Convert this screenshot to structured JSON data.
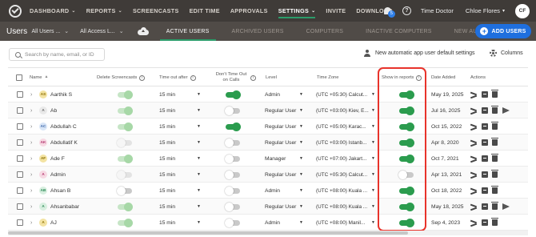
{
  "nav": {
    "items": [
      {
        "label": "DASHBOARD",
        "has_caret": true,
        "active": false
      },
      {
        "label": "REPORTS",
        "has_caret": true,
        "active": false
      },
      {
        "label": "SCREENCASTS",
        "has_caret": false,
        "active": false
      },
      {
        "label": "EDIT TIME",
        "has_caret": false,
        "active": false
      },
      {
        "label": "APPROVALS",
        "has_caret": false,
        "active": false
      },
      {
        "label": "SETTINGS",
        "has_caret": true,
        "active": true
      },
      {
        "label": "INVITE",
        "has_caret": false,
        "active": false
      },
      {
        "label": "DOWNLOAD",
        "has_caret": false,
        "active": false
      }
    ],
    "notification_count": "5",
    "help": "?",
    "company": "Time Doctor",
    "user": "Chloe Flores",
    "user_initials": "CF"
  },
  "subheader": {
    "title": "Users",
    "filter_users": "All Users ...",
    "filter_access": "All Access L...",
    "tabs": [
      {
        "label": "ACTIVE USERS",
        "active": true
      },
      {
        "label": "ARCHIVED USERS",
        "active": false
      },
      {
        "label": "COMPUTERS",
        "active": false
      },
      {
        "label": "INACTIVE COMPUTERS",
        "active": false
      },
      {
        "label": "NEW AUTOMATIC USERS",
        "active": false
      }
    ],
    "add_users_label": "ADD USERS"
  },
  "toolbar": {
    "search_placeholder": "Search by name, email, or ID",
    "defaults_label": "New automatic app user default settings",
    "columns_label": "Columns"
  },
  "table": {
    "headers": {
      "name": "Name",
      "delete_screencasts": "Delete Screencasts",
      "timeout": "Time out after",
      "dont_time_out": "Don't Time Out on Calls",
      "level": "Level",
      "timezone": "Time Zone",
      "show_in_reports": "Show in reports",
      "date_added": "Date Added",
      "actions": "Actions"
    },
    "rows": [
      {
        "initials": "AS",
        "avatar_bg": "#f3e3a2",
        "avatar_fg": "#8a6d00",
        "name": "Aarthik S",
        "delete_screencasts": "light-on",
        "timeout": "15 min",
        "dont_time_out": "on",
        "level": "Admin",
        "timezone": "(UTC +05:30) Calcut...",
        "show_in_reports": "on",
        "date_added": "May 19, 2025",
        "send": false
      },
      {
        "initials": "A",
        "avatar_bg": "#e9e9e9",
        "avatar_fg": "#666666",
        "name": "Ab",
        "delete_screencasts": "light-on",
        "timeout": "15 min",
        "dont_time_out": "off",
        "level": "Regular User",
        "timezone": "(UTC +03:00) Kiev, E...",
        "show_in_reports": "on",
        "date_added": "Jul 16, 2025",
        "send": true
      },
      {
        "initials": "AC",
        "avatar_bg": "#d9e6f7",
        "avatar_fg": "#3a64a8",
        "name": "Abdullah C",
        "delete_screencasts": "light-on",
        "timeout": "15 min",
        "dont_time_out": "on",
        "level": "Regular User",
        "timezone": "(UTC +05:00) Karac...",
        "show_in_reports": "on",
        "date_added": "Oct 15, 2022",
        "send": false
      },
      {
        "initials": "AK",
        "avatar_bg": "#f7d9e3",
        "avatar_fg": "#b0306a",
        "name": "Abdullatif K",
        "delete_screencasts": "light-off",
        "timeout": "15 min",
        "dont_time_out": "off",
        "level": "Regular User",
        "timezone": "(UTC +03:00) Istanb...",
        "show_in_reports": "on",
        "date_added": "Apr 8, 2020",
        "send": false
      },
      {
        "initials": "AF",
        "avatar_bg": "#f3e3a2",
        "avatar_fg": "#8a6d00",
        "name": "Ade F",
        "delete_screencasts": "light-on",
        "timeout": "15 min",
        "dont_time_out": "off",
        "level": "Manager",
        "timezone": "(UTC +07:00) Jakart...",
        "show_in_reports": "on",
        "date_added": "Oct 7, 2021",
        "send": false
      },
      {
        "initials": "A",
        "avatar_bg": "#f7d9e3",
        "avatar_fg": "#b0306a",
        "name": "Admin",
        "delete_screencasts": "light-off",
        "timeout": "15 min",
        "dont_time_out": "off",
        "level": "Regular User",
        "timezone": "(UTC +05:30) Calcut...",
        "show_in_reports": "off",
        "date_added": "Apr 13, 2021",
        "send": false
      },
      {
        "initials": "AB",
        "avatar_bg": "#d8efe0",
        "avatar_fg": "#2b8a55",
        "name": "Ahsan B",
        "delete_screencasts": "off",
        "timeout": "15 min",
        "dont_time_out": "off",
        "level": "Admin",
        "timezone": "(UTC +08:00) Kuala ...",
        "show_in_reports": "on",
        "date_added": "Oct 18, 2022",
        "send": false
      },
      {
        "initials": "A",
        "avatar_bg": "#d8efe0",
        "avatar_fg": "#2b8a55",
        "name": "Ahsanbabar",
        "delete_screencasts": "light-on",
        "timeout": "15 min",
        "dont_time_out": "off",
        "level": "Regular User",
        "timezone": "(UTC +08:00) Kuala ...",
        "show_in_reports": "on",
        "date_added": "May 18, 2025",
        "send": true
      },
      {
        "initials": "A",
        "avatar_bg": "#f3e3a2",
        "avatar_fg": "#8a6d00",
        "name": "AJ",
        "delete_screencasts": "light-on",
        "timeout": "15 min",
        "dont_time_out": "off",
        "level": "Admin",
        "timezone": "(UTC +08:00) Manil...",
        "show_in_reports": "on",
        "date_added": "Sep 4, 2023",
        "send": false
      }
    ]
  },
  "colors": {
    "nav_bg": "#3f3b38",
    "subheader_bg": "#504b47",
    "accent_green": "#2b9c4e",
    "add_button_blue": "#1f6fde",
    "highlight_red": "#e8332b"
  }
}
